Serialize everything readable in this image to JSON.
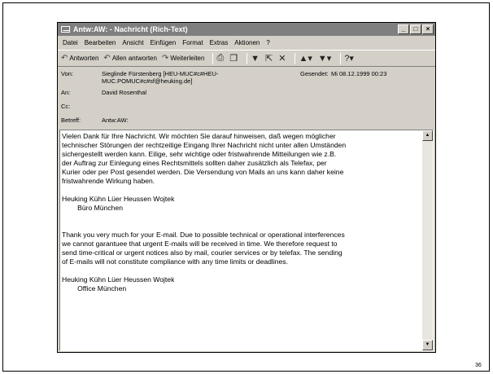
{
  "window": {
    "title": "Antw:AW: - Nachricht (Rich-Text)"
  },
  "menu": [
    "Datei",
    "Bearbeiten",
    "Ansicht",
    "Einfügen",
    "Format",
    "Extras",
    "Aktionen",
    "?"
  ],
  "toolbar": {
    "reply": "Antworten",
    "reply_all": "Allen antworten",
    "forward": "Weiterleiten"
  },
  "header": {
    "from_label": "Von:",
    "from_value": "Sieglinde Fürstenberg [HEU-MUC#c#HEU-MUC.POMUC#c#sf@heuking.de]",
    "sent_label": "Gesendet:",
    "sent_value": "Mi 08.12.1999 00:23",
    "to_label": "An:",
    "to_value": "David Rosenthal",
    "cc_label": "Cc:",
    "cc_value": "",
    "subject_label": "Betreff:",
    "subject_value": "Antw:AW:"
  },
  "body": {
    "text": "Vielen Dank für Ihre Nachricht. Wir möchten Sie darauf hinweisen, daß wegen möglicher\ntechnischer Störungen der rechtzeitige Eingang Ihrer Nachricht nicht unter allen Umständen\nsichergestellt werden kann. Eilige, sehr wichtige oder fristwahrende Mitteilungen wie z.B.\nder Auftrag zur Einlegung eines Rechtsmittels sollten daher zusätzlich als Telefax, per\nKurier oder per Post gesendet werden. Die Versendung von Mails an uns kann daher keine\nfristwahrende Wirkung haben.\n\nHeuking Kühn Lüer Heussen Wojtek\n        Büro München\n\n\nThank you very much for your E-mail. Due to possible technical or operational interferences\nwe cannot garantuee that urgent E-mails will be received in time. We therefore request to\nsend time-critical or urgent notices also by mail, courier services or by telefax. The sending\nof E-mails will not constitute compliance with any time limits or deadlines.\n\nHeuking Kühn Lüer Heussen Wojtek\n        Office München"
  },
  "page_number": "36"
}
